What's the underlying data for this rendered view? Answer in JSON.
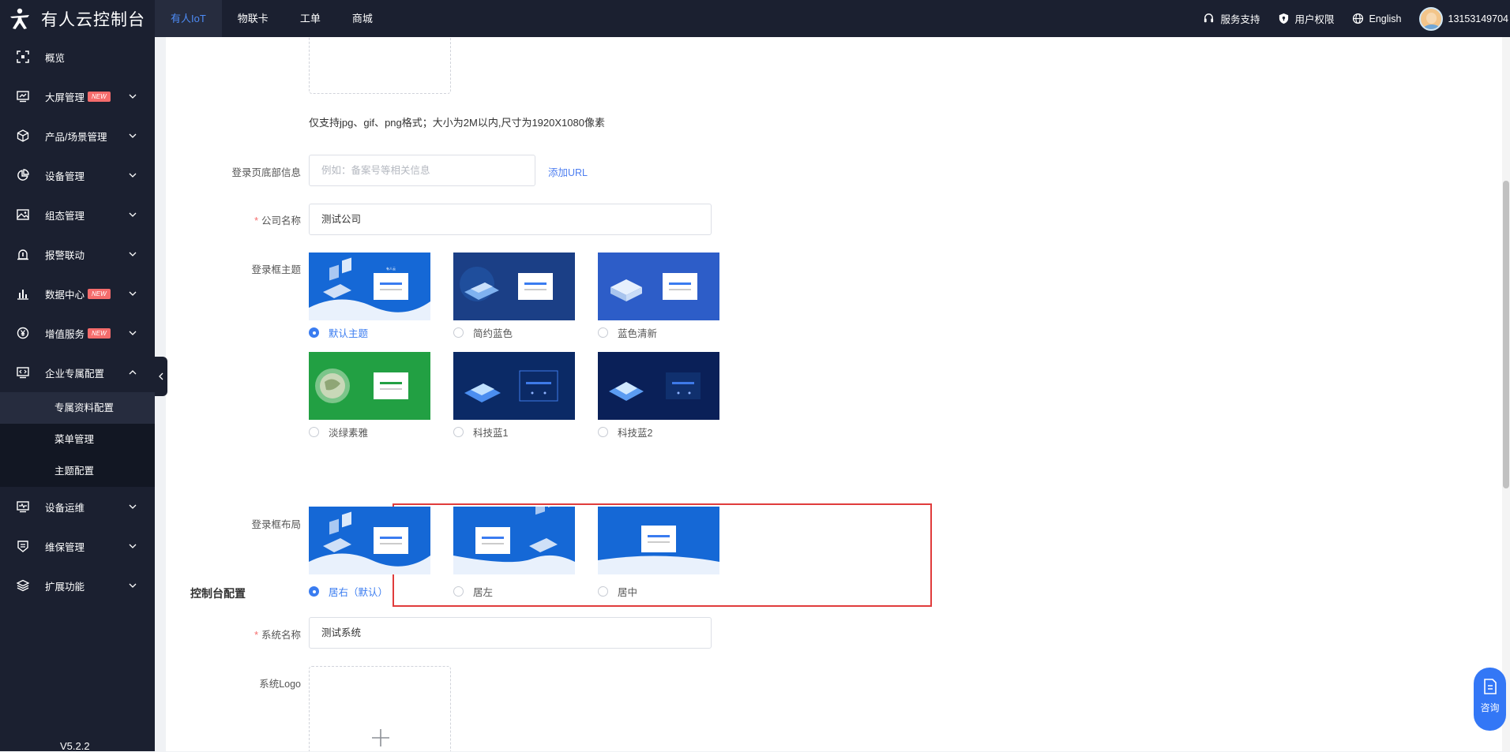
{
  "app": {
    "title": "有人云控制台",
    "version": "V5.2.2"
  },
  "topnav": [
    {
      "label": "有人IoT",
      "active": true
    },
    {
      "label": "物联卡",
      "active": false
    },
    {
      "label": "工单",
      "active": false
    },
    {
      "label": "商城",
      "active": false
    }
  ],
  "topright": {
    "support": "服务支持",
    "permissions": "用户权限",
    "language": "English",
    "username": "13153149704"
  },
  "sidebar": {
    "items": [
      {
        "label": "概览",
        "icon": "scan-icon",
        "has_arrow": false,
        "badge": ""
      },
      {
        "label": "大屏管理",
        "icon": "screen-icon",
        "has_arrow": true,
        "badge": "NEW"
      },
      {
        "label": "产品/场景管理",
        "icon": "cube-icon",
        "has_arrow": true,
        "badge": ""
      },
      {
        "label": "设备管理",
        "icon": "pie-icon",
        "has_arrow": true,
        "badge": ""
      },
      {
        "label": "组态管理",
        "icon": "image-icon",
        "has_arrow": true,
        "badge": ""
      },
      {
        "label": "报警联动",
        "icon": "alarm-icon",
        "has_arrow": true,
        "badge": ""
      },
      {
        "label": "数据中心",
        "icon": "bar-chart-icon",
        "has_arrow": true,
        "badge": "NEW"
      },
      {
        "label": "增值服务",
        "icon": "yen-icon",
        "has_arrow": true,
        "badge": "NEW"
      },
      {
        "label": "企业专属配置",
        "icon": "code-monitor-icon",
        "has_arrow": true,
        "badge": "",
        "expanded": true
      }
    ],
    "subitems": [
      {
        "label": "专属资料配置",
        "active": true
      },
      {
        "label": "菜单管理",
        "active": false
      },
      {
        "label": "主题配置",
        "active": false
      }
    ],
    "items_after": [
      {
        "label": "设备运维",
        "icon": "monitor-pulse-icon",
        "badge": ""
      },
      {
        "label": "维保管理",
        "icon": "shield-list-icon",
        "badge": ""
      },
      {
        "label": "扩展功能",
        "icon": "layers-icon",
        "badge": ""
      }
    ]
  },
  "form": {
    "image_hint": "仅支持jpg、gif、png格式；大小为2M以内,尺寸为1920X1080像素",
    "footer_label": "登录页底部信息",
    "footer_placeholder": "例如：备案号等相关信息",
    "add_url": "添加URL",
    "company_label": "公司名称",
    "company_value": "测试公司",
    "theme_label": "登录框主题",
    "themes": [
      {
        "label": "默认主题",
        "checked": true
      },
      {
        "label": "简约蓝色",
        "checked": false
      },
      {
        "label": "蓝色清新",
        "checked": false
      },
      {
        "label": "淡绿素雅",
        "checked": false
      },
      {
        "label": "科技蓝1",
        "checked": false
      },
      {
        "label": "科技蓝2",
        "checked": false
      }
    ],
    "layout_label": "登录框布局",
    "layouts": [
      {
        "label": "居右（默认）",
        "checked": true
      },
      {
        "label": "居左",
        "checked": false
      },
      {
        "label": "居中",
        "checked": false
      }
    ],
    "console_section": "控制台配置",
    "system_name_label": "系统名称",
    "system_name_value": "测试系统",
    "system_logo_label": "系统Logo"
  },
  "consult": {
    "label": "咨询"
  },
  "colors": {
    "sidebar_bg": "#1b2030",
    "accent": "#3a7cf0",
    "highlight": "#e03c3c"
  },
  "login_preview": {
    "brand": "有人云"
  }
}
